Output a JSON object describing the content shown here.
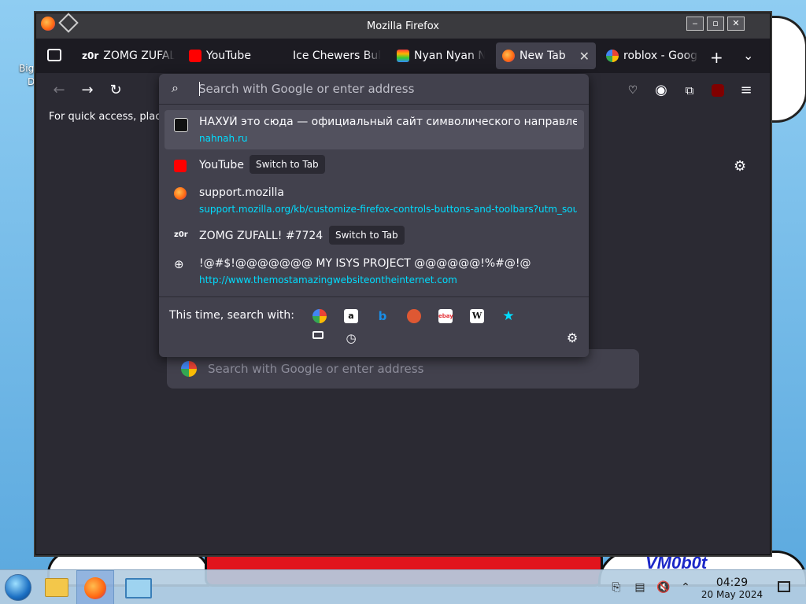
{
  "window": {
    "title": "Mozilla Firefox"
  },
  "tabs": [
    {
      "label": "ZOMG ZUFALL!",
      "favicon_text": "z0r"
    },
    {
      "label": "YouTube"
    },
    {
      "label": "Ice Chewers Bull"
    },
    {
      "label": "Nyan Nyan N"
    },
    {
      "label": "New Tab",
      "active": true
    },
    {
      "label": "roblox - Goog"
    }
  ],
  "bookmarks_bar": {
    "text": "For quick access, plac"
  },
  "url_dropdown": {
    "placeholder": "Search with Google or enter address",
    "results": [
      {
        "title": "НАХУЙ это сюда — официальный сайт символического направле",
        "url": "nahnah.ru"
      },
      {
        "title": "YouTube",
        "badge": "Switch to Tab"
      },
      {
        "title": "support.mozilla",
        "url": "support.mozilla.org/kb/customize-firefox-controls-buttons-and-toolbars?utm_sou"
      },
      {
        "title": "ZOMG ZUFALL! #7724",
        "badge": "Switch to Tab",
        "favicon_text": "z0r"
      },
      {
        "title": "!@#$!@@@@@@@ MY ISYS PROJECT @@@@@@!%#@!@",
        "url": "http://www.themostamazingwebsiteontheinternet.com"
      }
    ],
    "oneoff_label": "This time, search with:",
    "engines": [
      "google",
      "amazon",
      "bing",
      "duckduckgo",
      "ebay",
      "wikipedia",
      "bookmarks",
      "tabs",
      "history"
    ],
    "engine_glyphs": {
      "wikipedia": "W",
      "ebay": "ebay"
    }
  },
  "content": {
    "search_placeholder": "Search with Google or enter address"
  },
  "desktop": {
    "icon_label_1": "Big",
    "icon_label_2": "De",
    "wallpaper_text": "VM0b0t"
  },
  "taskbar": {
    "time": "04:29",
    "date": "20 May 2024"
  },
  "colors": {
    "accent_url": "#00ddff",
    "panel": "#42414d",
    "chrome": "#2b2a33"
  }
}
